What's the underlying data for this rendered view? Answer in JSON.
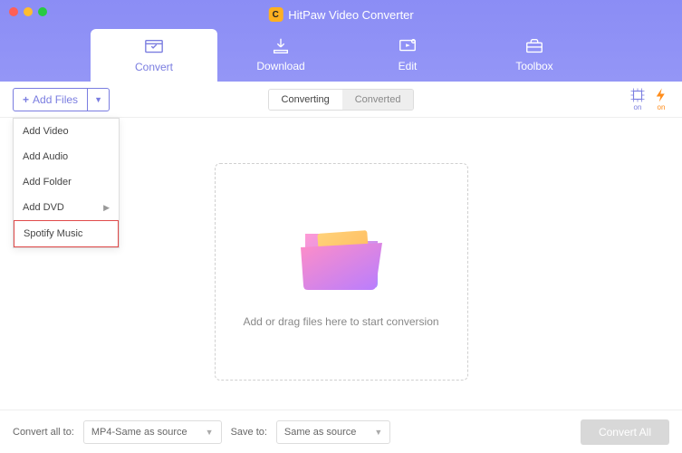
{
  "app": {
    "title": "HitPaw Video Converter",
    "logo_letter": "C"
  },
  "tabs": {
    "convert": "Convert",
    "download": "Download",
    "edit": "Edit",
    "toolbox": "Toolbox"
  },
  "toolbar": {
    "add_files": "Add Files",
    "segment_converting": "Converting",
    "segment_converted": "Converted",
    "hw1_sub": "on",
    "hw2_sub": "on"
  },
  "dropdown": {
    "items": [
      {
        "label": "Add Video",
        "sub": false
      },
      {
        "label": "Add Audio",
        "sub": false
      },
      {
        "label": "Add Folder",
        "sub": false
      },
      {
        "label": "Add DVD",
        "sub": true
      },
      {
        "label": "Spotify Music",
        "sub": false
      }
    ]
  },
  "dropzone": {
    "text": "Add or drag files here to start conversion"
  },
  "footer": {
    "convert_all_label": "Convert all to:",
    "convert_all_value": "MP4-Same as source",
    "save_to_label": "Save to:",
    "save_to_value": "Same as source",
    "convert_all_btn": "Convert All"
  }
}
